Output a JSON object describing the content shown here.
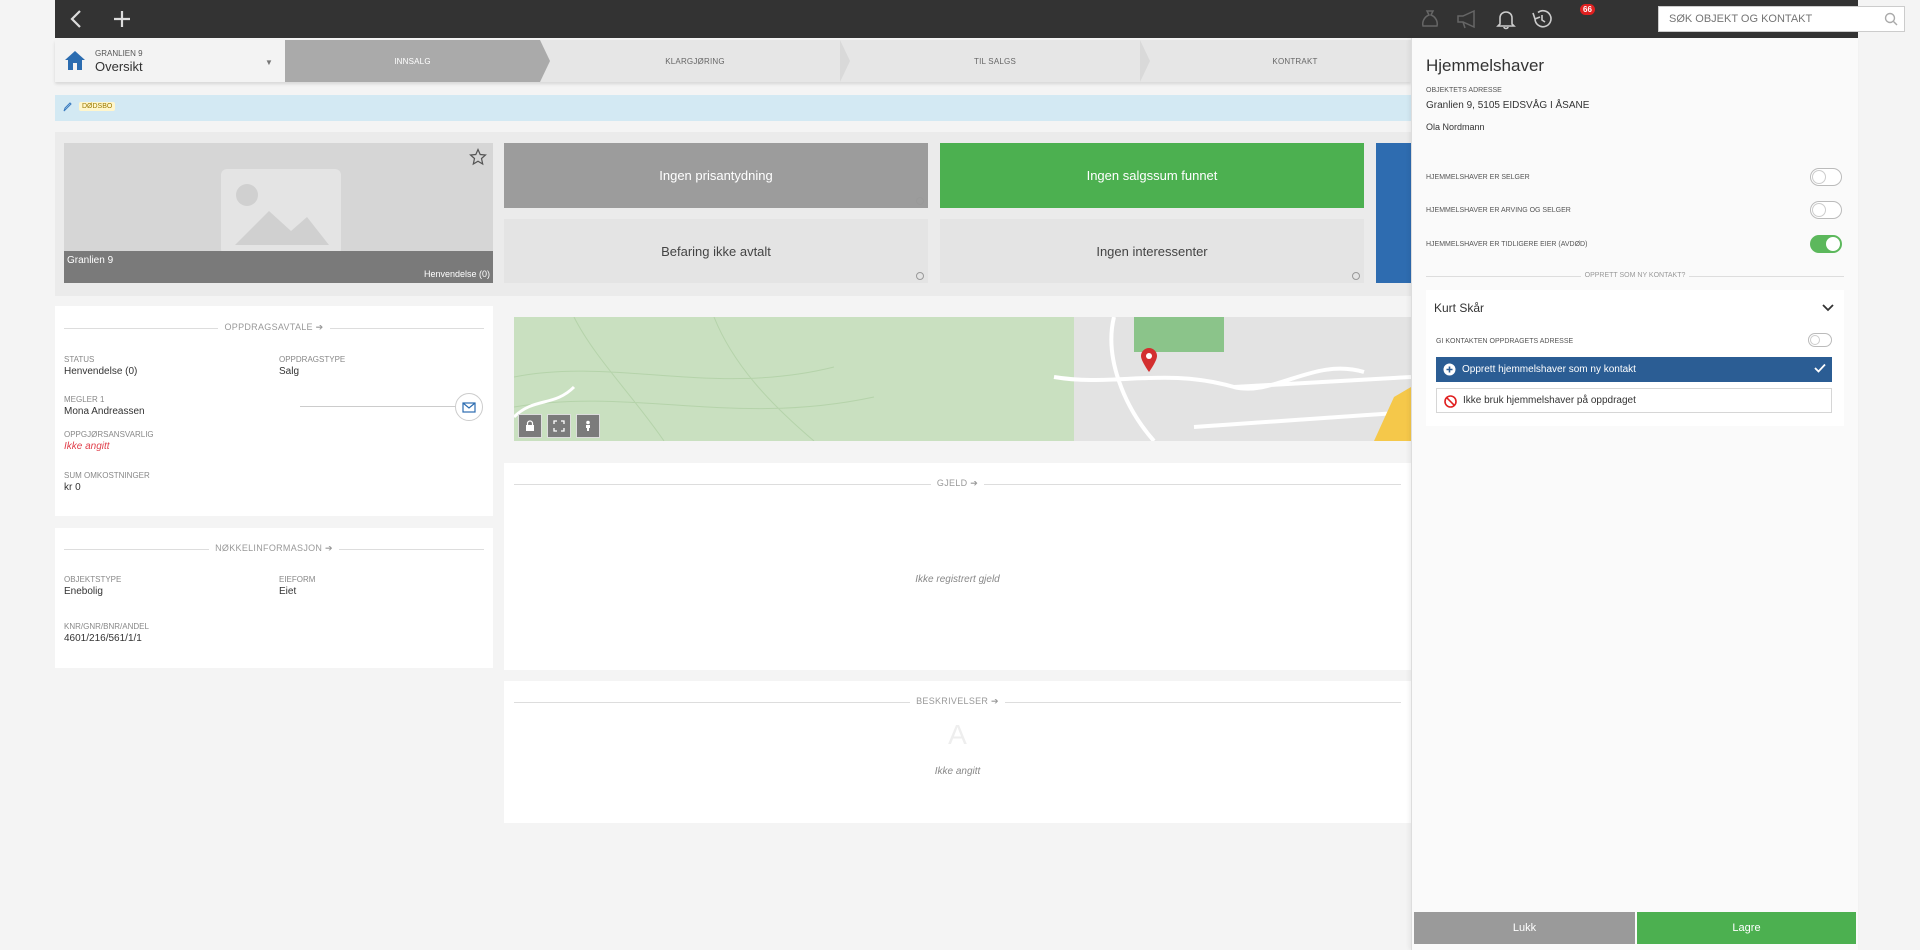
{
  "topbar": {
    "search_placeholder": "SØK OBJEKT OG KONTAKT",
    "notification_count": "66"
  },
  "header": {
    "address_small": "GRANLIEN 9",
    "view_title": "Oversikt",
    "steps": [
      "INNSALG",
      "KLARGJØRING",
      "TIL SALGS",
      "KONTRAKT"
    ]
  },
  "infobar": {
    "tag": "DØDSBO"
  },
  "photo": {
    "name": "Granlien 9",
    "inquiry": "Henvendelse (0)"
  },
  "tiles": {
    "price": "Ingen prisantydning",
    "sales_sum": "Ingen salgssum funnet",
    "inspection": "Befaring ikke avtalt",
    "interested": "Ingen interessenter"
  },
  "assignment": {
    "title": "OPPDRAGSAVTALE",
    "status_label": "STATUS",
    "status_value": "Henvendelse (0)",
    "type_label": "OPPDRAGSTYPE",
    "type_value": "Salg",
    "broker_label": "MEGLER 1",
    "broker_value": "Mona Andreassen",
    "settlement_label": "OPPGJØRSANSVARLIG",
    "settlement_value": "Ikke angitt",
    "costs_label": "SUM OMKOSTNINGER",
    "costs_value": "kr 0"
  },
  "keyinfo": {
    "title": "NØKKELINFORMASJON",
    "objtype_label": "OBJEKTSTYPE",
    "objtype_value": "Enebolig",
    "ownership_label": "EIEFORM",
    "ownership_value": "Eiet",
    "cadastre_label": "KNR/GNR/BNR/ANDEL",
    "cadastre_value": "4601/216/561/1/1"
  },
  "debt": {
    "title": "GJELD",
    "empty": "Ikke registrert gjeld"
  },
  "descriptions": {
    "title": "BESKRIVELSER",
    "empty": "Ikke angitt"
  },
  "panel": {
    "title": "Hjemmelshaver",
    "address_label": "OBJEKTETS ADRESSE",
    "address_value": "Granlien 9, 5105 EIDSVÅG I ÅSANE",
    "owner_name": "Ola Nordmann",
    "toggles": [
      {
        "label": "HJEMMELSHAVER ER SELGER",
        "on": false
      },
      {
        "label": "HJEMMELSHAVER ER ARVING OG SELGER",
        "on": false
      },
      {
        "label": "HJEMMELSHAVER ER TIDLIGERE EIER (AVDØD)",
        "on": true
      }
    ],
    "create_contact_label": "OPPRETT SOM NY KONTAKT?",
    "contact_name": "Kurt Skår",
    "give_address_label": "GI KONTAKTEN OPPDRAGETS ADRESSE",
    "option_create": "Opprett hjemmelshaver som ny kontakt",
    "option_skip": "Ikke bruk hjemmelshaver på oppdraget",
    "close_label": "Lukk",
    "save_label": "Lagre"
  },
  "colors": {
    "accent_green": "#4cb050",
    "accent_blue": "#2b5d94",
    "topbar": "#333333"
  }
}
